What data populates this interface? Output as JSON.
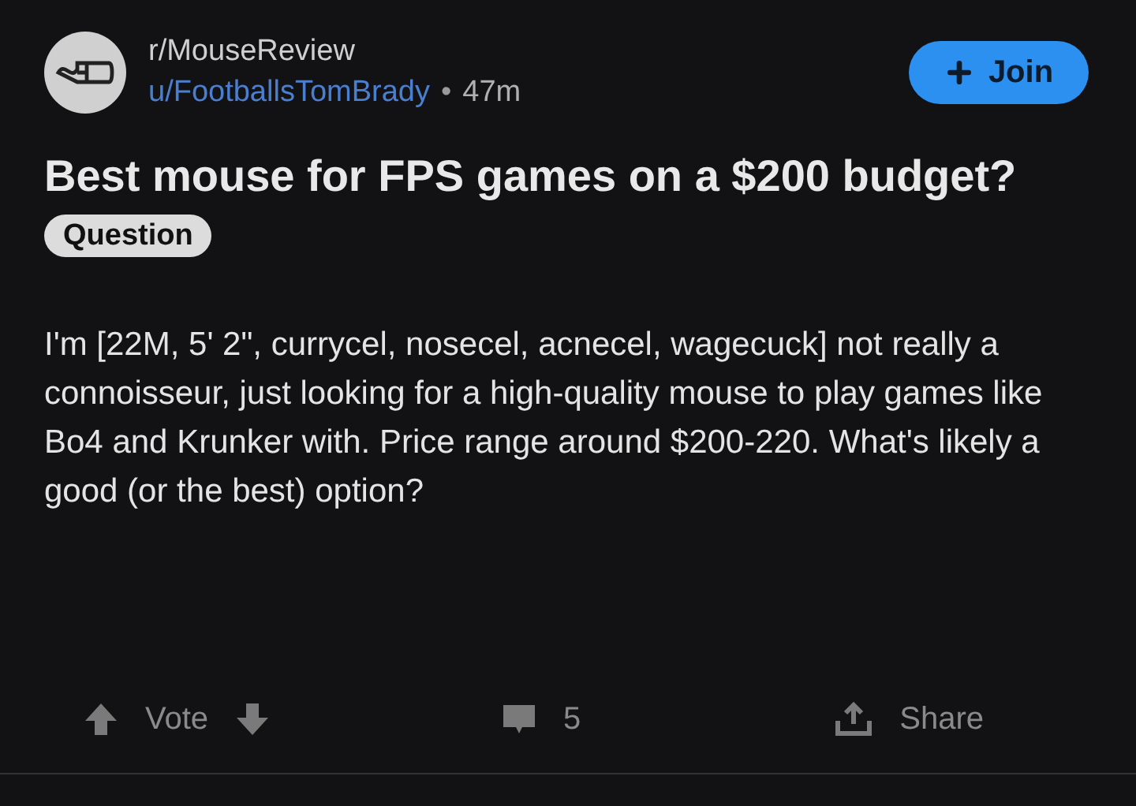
{
  "post": {
    "subreddit": "r/MouseReview",
    "author": "u/FootballsTomBrady",
    "separator": "•",
    "age": "47m",
    "join_button": "Join",
    "title": "Best mouse for FPS games on a $200 budget?",
    "flair": "Question",
    "body": "I'm [22M, 5' 2\", currycel, nosecel, acnecel, wagecuck] not really a connoisseur, just looking for a high-quality mouse to play games like Bo4 and Krunker with. Price range around $200-220. What's likely a good (or the best) option?"
  },
  "actions": {
    "vote_label": "Vote",
    "comment_count": "5",
    "share_label": "Share"
  }
}
